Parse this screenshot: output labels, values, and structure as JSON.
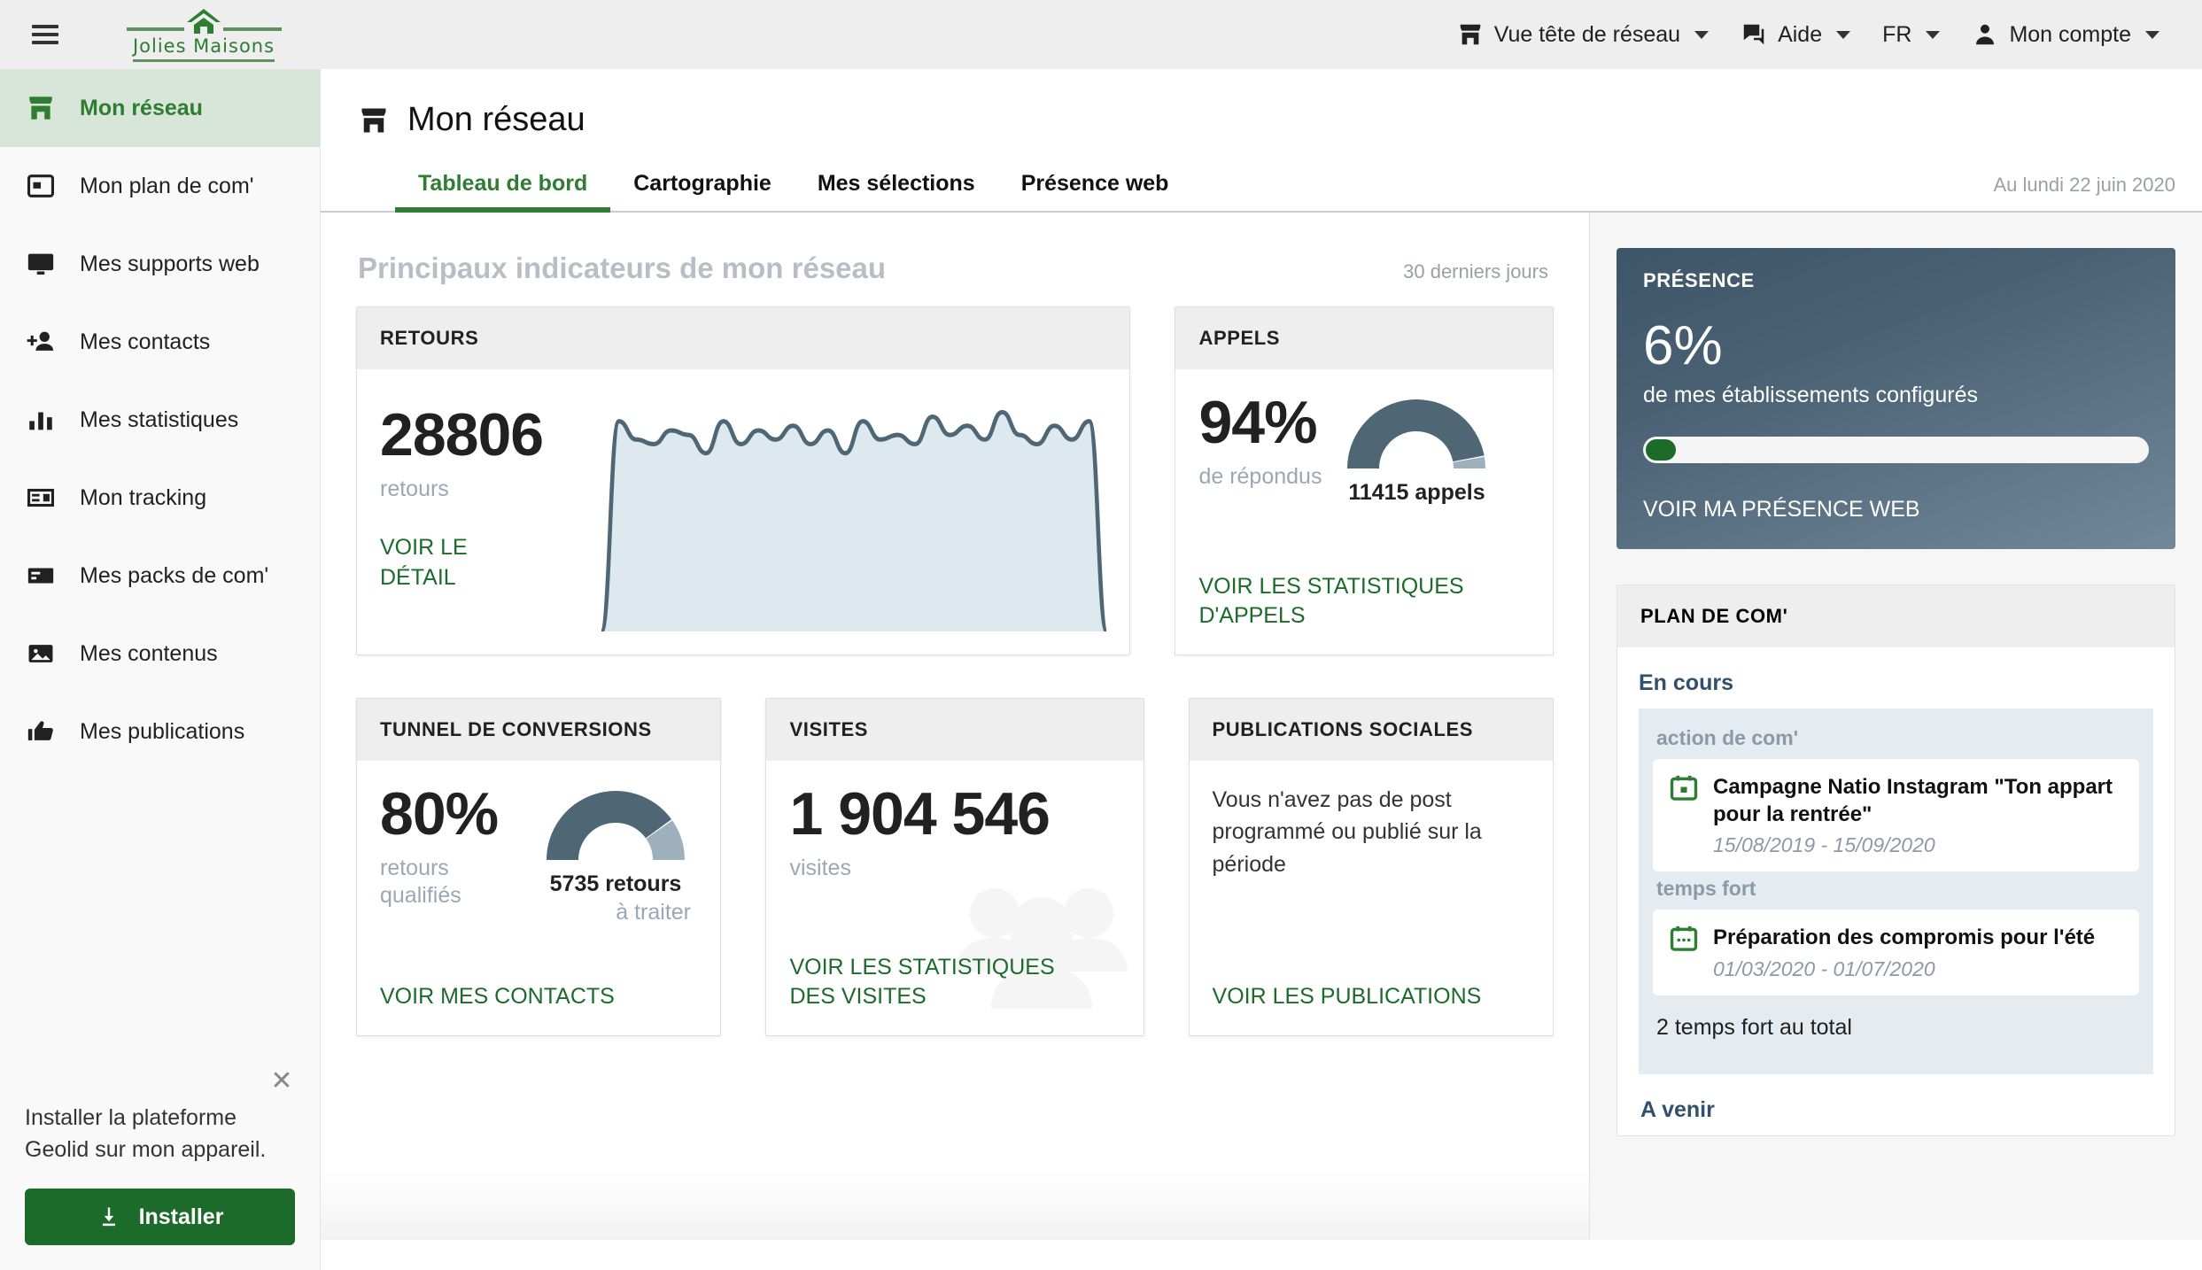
{
  "topbar": {
    "menu_icon": "hamburger-icon",
    "logo_text": "Jolies Maisons",
    "nav": [
      {
        "label": "Vue tête de réseau",
        "icon": "store-icon",
        "caret": true
      },
      {
        "label": "Aide",
        "icon": "chat-icon",
        "caret": true
      },
      {
        "label": "FR",
        "icon": "",
        "caret": true
      },
      {
        "label": "Mon compte",
        "icon": "person-icon",
        "caret": true
      }
    ]
  },
  "sidebar": {
    "items": [
      {
        "label": "Mon réseau",
        "icon": "store-icon",
        "active": true
      },
      {
        "label": "Mon plan de com'",
        "icon": "calendar-icon",
        "active": false
      },
      {
        "label": "Mes supports web",
        "icon": "monitor-icon",
        "active": false
      },
      {
        "label": "Mes contacts",
        "icon": "person-add-icon",
        "active": false
      },
      {
        "label": "Mes statistiques",
        "icon": "bar-chart-icon",
        "active": false
      },
      {
        "label": "Mon tracking",
        "icon": "tracking-icon",
        "active": false
      },
      {
        "label": "Mes packs de com'",
        "icon": "card-icon",
        "active": false
      },
      {
        "label": "Mes contenus",
        "icon": "image-icon",
        "active": false
      },
      {
        "label": "Mes publications",
        "icon": "thumb-up-icon",
        "active": false
      }
    ],
    "install": {
      "close_icon": "close-icon",
      "text": "Installer la plateforme Geolid sur mon appareil.",
      "button_label": "Installer",
      "button_icon": "download-icon"
    }
  },
  "page": {
    "title": "Mon réseau",
    "title_icon": "store-icon",
    "tabs": [
      {
        "label": "Tableau de bord",
        "active": true
      },
      {
        "label": "Cartographie",
        "active": false
      },
      {
        "label": "Mes sélections",
        "active": false
      },
      {
        "label": "Présence web",
        "active": false
      }
    ],
    "section_title": "Principaux indicateurs de mon réseau",
    "section_period": "30 derniers jours",
    "rail_date": "Au lundi 22 juin 2020"
  },
  "cards": {
    "retours": {
      "title": "RETOURS",
      "value": "28806",
      "unit": "retours",
      "cta": "VOIR LE DÉTAIL"
    },
    "appels": {
      "title": "APPELS",
      "value": "94%",
      "unit": "de répondus",
      "gauge_caption": "11415 appels",
      "cta": "VOIR LES STATISTIQUES D'APPELS"
    },
    "tunnel": {
      "title": "TUNNEL DE CONVERSIONS",
      "value": "80%",
      "unit": "retours qualifiés",
      "gauge_caption_bold": "5735 retours",
      "gauge_caption_light": "à traiter",
      "cta": "VOIR MES CONTACTS"
    },
    "visites": {
      "title": "VISITES",
      "value": "1 904 546",
      "unit": "visites",
      "cta": "VOIR LES STATISTIQUES DES VISITES",
      "watermark_icon": "people-group-icon"
    },
    "publications": {
      "title": "PUBLICATIONS SOCIALES",
      "message": "Vous n'avez pas de post programmé ou publié sur la période",
      "cta": "VOIR LES PUBLICATIONS"
    }
  },
  "presence": {
    "title": "PRÉSENCE",
    "value": "6%",
    "subtitle": "de mes établissements configurés",
    "progress_percent": 6,
    "cta": "VOIR MA PRÉSENCE WEB"
  },
  "plan": {
    "title": "PLAN DE COM'",
    "current_group": "En cours",
    "kind_action": "action de com'",
    "kind_temps": "temps fort",
    "item_action": {
      "icon": "calendar-event-icon",
      "title": "Campagne Natio Instagram \"Ton appart pour la rentrée\"",
      "dates": "15/08/2019 - 15/09/2020"
    },
    "item_temps": {
      "icon": "calendar-event-icon",
      "title": "Préparation des compromis pour l'été",
      "dates": "01/03/2020 - 01/07/2020"
    },
    "total": "2 temps fort au total",
    "next_group": "A venir"
  },
  "colors": {
    "green": "#2e7d32",
    "green_dark": "#1d6b2a",
    "slate": "#4f6675",
    "slate_light": "#9fb0bd",
    "area_fill": "#dde8ef",
    "card_head": "#eeeeee"
  },
  "chart_data": {
    "type": "area",
    "title": "Retours sur 30 jours",
    "xlabel": "",
    "ylabel": "retours",
    "grid": false,
    "legend": "none",
    "x": [
      1,
      2,
      3,
      4,
      5,
      6,
      7,
      8,
      9,
      10,
      11,
      12,
      13,
      14,
      15,
      16,
      17,
      18,
      19,
      20,
      21,
      22,
      23,
      24,
      25,
      26,
      27,
      28,
      29,
      30
    ],
    "values": [
      0,
      92,
      84,
      82,
      88,
      86,
      78,
      92,
      82,
      88,
      84,
      90,
      82,
      88,
      78,
      92,
      84,
      86,
      82,
      94,
      86,
      90,
      84,
      96,
      86,
      82,
      90,
      84,
      92,
      0
    ],
    "ylim": [
      0,
      100
    ],
    "total": 28806
  },
  "gauges": [
    {
      "name": "appels",
      "percent": 94,
      "filled_color": "#4f6675",
      "rest_color": "#9fb0bd"
    },
    {
      "name": "tunnel",
      "percent": 80,
      "filled_color": "#4f6675",
      "rest_color": "#9fb0bd"
    }
  ]
}
